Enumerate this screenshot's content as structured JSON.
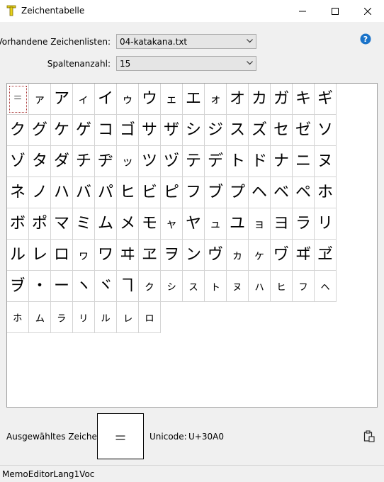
{
  "window": {
    "title": "Zeichentabelle"
  },
  "controls": {
    "lists_label": "Vorhandene Zeichenlisten:",
    "lists_value": "04-katakana.txt",
    "columns_label": "Spaltenanzahl:",
    "columns_value": "15"
  },
  "grid": {
    "cells": [
      "゠",
      "ァ",
      "ア",
      "ィ",
      "イ",
      "ゥ",
      "ウ",
      "ェ",
      "エ",
      "ォ",
      "オ",
      "カ",
      "ガ",
      "キ",
      "ギ",
      "ク",
      "グ",
      "ケ",
      "ゲ",
      "コ",
      "ゴ",
      "サ",
      "ザ",
      "シ",
      "ジ",
      "ス",
      "ズ",
      "セ",
      "ゼ",
      "ソ",
      "ゾ",
      "タ",
      "ダ",
      "チ",
      "ヂ",
      "ッ",
      "ツ",
      "ヅ",
      "テ",
      "デ",
      "ト",
      "ド",
      "ナ",
      "ニ",
      "ヌ",
      "ネ",
      "ノ",
      "ハ",
      "バ",
      "パ",
      "ヒ",
      "ビ",
      "ピ",
      "フ",
      "ブ",
      "プ",
      "ヘ",
      "ベ",
      "ペ",
      "ホ",
      "ボ",
      "ポ",
      "マ",
      "ミ",
      "ム",
      "メ",
      "モ",
      "ャ",
      "ヤ",
      "ュ",
      "ユ",
      "ョ",
      "ヨ",
      "ラ",
      "リ",
      "ル",
      "レ",
      "ロ",
      "ヮ",
      "ワ",
      "ヰ",
      "ヱ",
      "ヲ",
      "ン",
      "ヴ",
      "ヵ",
      "ヶ",
      "ヷ",
      "ヸ",
      "ヹ",
      "ヺ",
      "・",
      "ー",
      "ヽ",
      "ヾ",
      "ヿ",
      "ㇰ",
      "ㇱ",
      "ㇲ",
      "ㇳ",
      "ㇴ",
      "ㇵ",
      "ㇶ",
      "ㇷ",
      "ㇸ",
      "ㇹ",
      "ㇺ",
      "ㇻ",
      "ㇼ",
      "ㇽ",
      "ㇾ",
      "ㇿ"
    ],
    "selected_index": 0
  },
  "selection": {
    "label": "Ausgewähltes Zeichen:",
    "char": "゠",
    "unicode_label": "Unicode:",
    "unicode_value": "U+30A0"
  },
  "status": {
    "text": "MemoEditorLang1Voc"
  },
  "icons": {
    "app": "tuning-fork-icon",
    "help": "help-icon",
    "clipboard": "clipboard-copy-icon"
  },
  "colors": {
    "help_blue": "#1a73c9",
    "app_icon_yellow": "#e8d21a"
  }
}
